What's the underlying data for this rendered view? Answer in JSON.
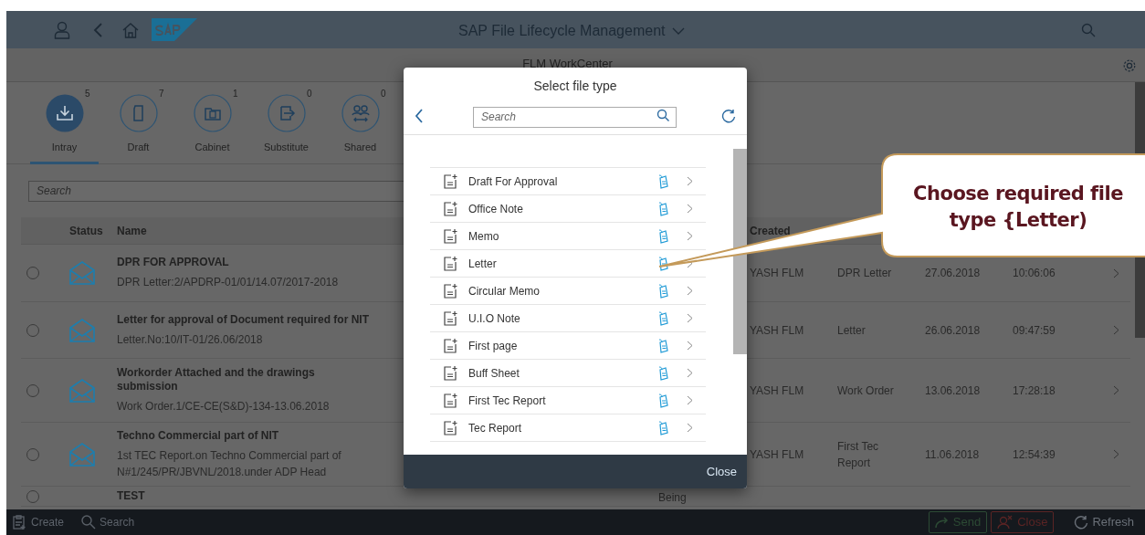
{
  "shell": {
    "title": "SAP File Lifecycle Management",
    "subtitle": "FLM WorkCenter"
  },
  "tabs": [
    {
      "label": "Intray",
      "count": "5",
      "selected": true
    },
    {
      "label": "Draft",
      "count": "7",
      "selected": false
    },
    {
      "label": "Cabinet",
      "count": "1",
      "selected": false
    },
    {
      "label": "Substitute",
      "count": "0",
      "selected": false
    },
    {
      "label": "Shared",
      "count": "0",
      "selected": false
    }
  ],
  "search": {
    "placeholder": "Search"
  },
  "table": {
    "columns": [
      "Status",
      "Name",
      "Created"
    ],
    "rows": [
      {
        "title": "DPR FOR APPROVAL",
        "reference": "DPR Letter:2/APDRP-01/01/14.07/2017-2018",
        "created_by": "YASH FLM",
        "type": "DPR Letter",
        "date": "27.06.2018",
        "time": "10:06:06",
        "selected": false
      },
      {
        "title": "Letter for approval of Document required for NIT",
        "reference": "Letter.No:10/IT-01/26.06/2018",
        "created_by": "YASH FLM",
        "type": "Letter",
        "date": "26.06.2018",
        "time": "09:47:59",
        "selected": false
      },
      {
        "title": "Workorder Attached and the drawings submission",
        "reference": "Work Order.1/CE-CE(S&D)-134-13.06.2018",
        "created_by": "YASH FLM",
        "type": "Work Order",
        "date": "13.06.2018",
        "time": "17:28:18",
        "selected": false
      },
      {
        "title": "Techno Commercial part of NIT",
        "reference": "1st TEC Report.on Techno Commercial part of N#1/245/PR/JBVNL/2018.under ADP Head",
        "created_by": "YASH FLM",
        "type": "First Tec Report",
        "date": "11.06.2018",
        "time": "12:54:39",
        "selected": false
      },
      {
        "title": "TEST",
        "column_4": "Being",
        "selected": false
      }
    ]
  },
  "footer": {
    "left": [
      "Create",
      "Search"
    ],
    "right": [
      {
        "label": "Send",
        "kind": "send"
      },
      {
        "label": "Close",
        "kind": "close"
      },
      {
        "label": "Refresh",
        "kind": "refresh"
      }
    ]
  },
  "dialog": {
    "title": "Select file type",
    "search_placeholder": "Search",
    "items": [
      "Draft For Approval",
      "Office Note",
      "Memo",
      "Letter",
      "Circular Memo",
      "U.I.O Note",
      "First page",
      "Buff Sheet",
      "First Tec Report",
      "Tec Report"
    ],
    "close": "Close"
  },
  "callout": {
    "text": "Choose required file type {Letter)"
  }
}
